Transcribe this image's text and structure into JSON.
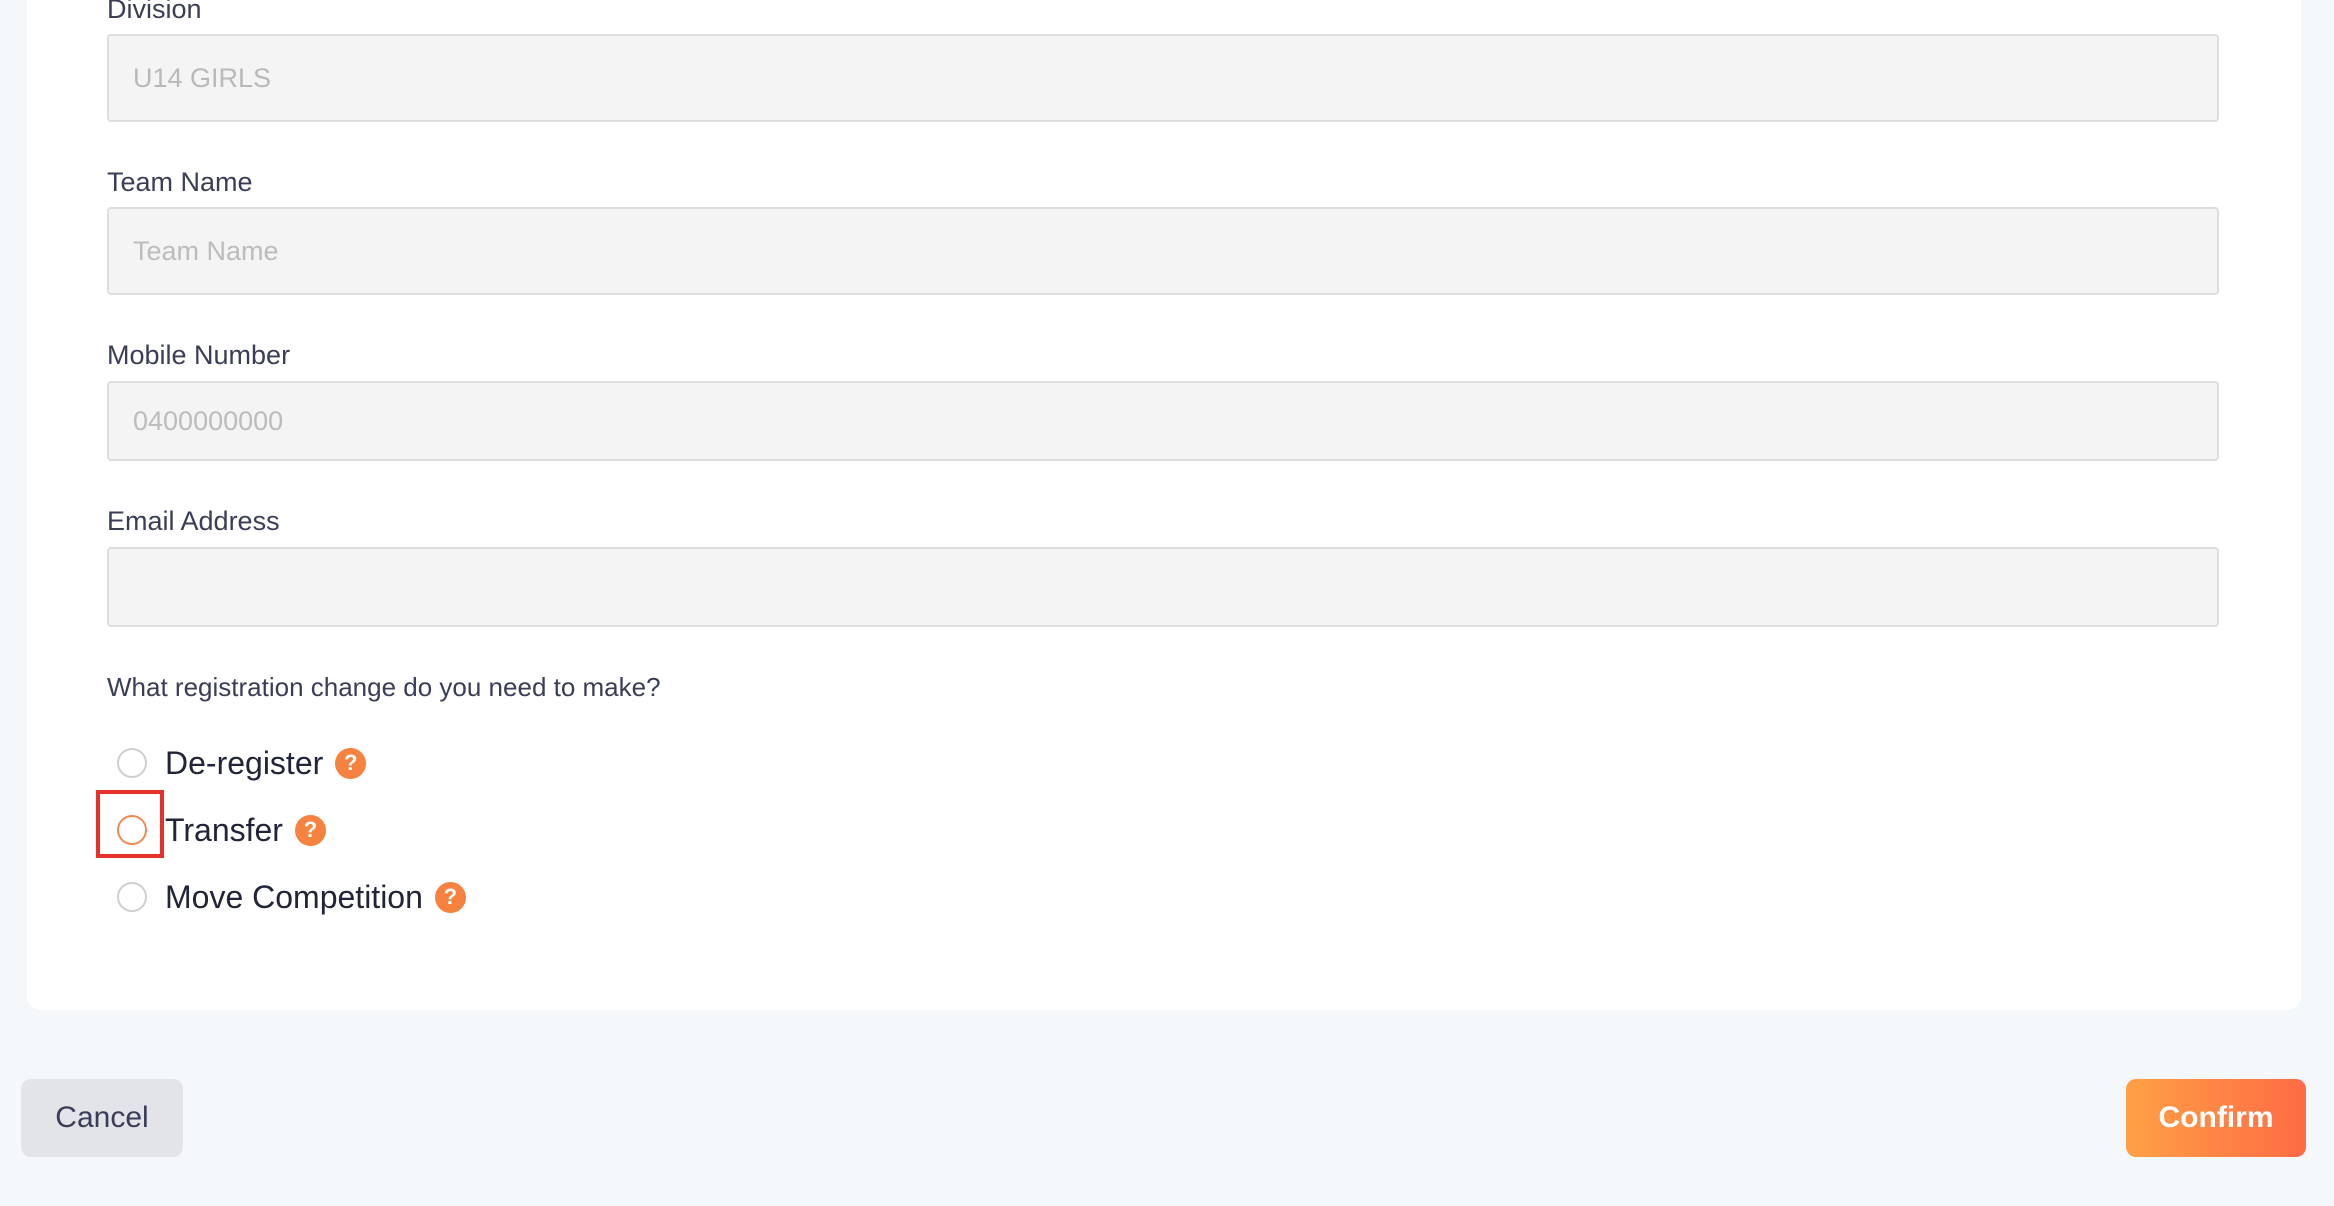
{
  "form": {
    "division": {
      "label": "Division",
      "value": "U14 GIRLS"
    },
    "team_name": {
      "label": "Team Name",
      "placeholder": "Team Name",
      "value": ""
    },
    "mobile": {
      "label": "Mobile Number",
      "placeholder": "0400000000",
      "value": ""
    },
    "email": {
      "label": "Email Address",
      "placeholder": "",
      "value": ""
    },
    "question": "What registration change do you need to make?",
    "options": [
      {
        "label": "De-register",
        "selected": false
      },
      {
        "label": "Transfer",
        "selected": false
      },
      {
        "label": "Move Competition",
        "selected": false
      }
    ],
    "help_glyph": "?"
  },
  "footer": {
    "cancel_label": "Cancel",
    "confirm_label": "Confirm"
  },
  "colors": {
    "accent": "#f5823f",
    "confirm_start": "#ffa045",
    "confirm_end": "#ff6b45",
    "highlight": "#e4312a"
  }
}
